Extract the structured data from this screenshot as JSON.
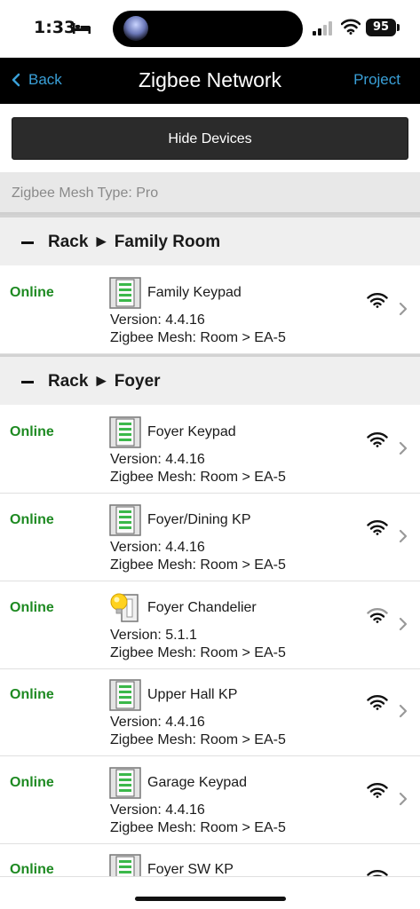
{
  "status_bar": {
    "time": "1:33",
    "battery": "95"
  },
  "nav": {
    "back_label": "Back",
    "title": "Zigbee Network",
    "project_label": "Project"
  },
  "toolbar": {
    "hide_devices_label": "Hide Devices"
  },
  "mesh_type": "Zigbee Mesh Type: Pro",
  "colors": {
    "online": "#1e8a22",
    "nav_link": "#3aa0d8",
    "nav_bg": "#000000"
  },
  "sections": [
    {
      "title": "Rack ► Family Room"
    },
    {
      "title": "Rack ► Foyer"
    }
  ],
  "devices": [
    {
      "status": "Online",
      "name": "Family Keypad",
      "version": "Version: 4.4.16",
      "mesh": "Zigbee Mesh: Room > EA-5",
      "icon": "keypad-icon"
    },
    {
      "status": "Online",
      "name": "Foyer Keypad",
      "version": "Version: 4.4.16",
      "mesh": "Zigbee Mesh: Room > EA-5",
      "icon": "keypad-icon"
    },
    {
      "status": "Online",
      "name": "Foyer/Dining KP",
      "version": "Version: 4.4.16",
      "mesh": "Zigbee Mesh: Room > EA-5",
      "icon": "keypad-icon"
    },
    {
      "status": "Online",
      "name": "Foyer Chandelier",
      "version": "Version: 5.1.1",
      "mesh": "Zigbee Mesh: Room > EA-5",
      "icon": "dimmer-bulb-icon"
    },
    {
      "status": "Online",
      "name": "Upper Hall KP",
      "version": "Version: 4.4.16",
      "mesh": "Zigbee Mesh: Room > EA-5",
      "icon": "keypad-icon"
    },
    {
      "status": "Online",
      "name": "Garage Keypad",
      "version": "Version: 4.4.16",
      "mesh": "Zigbee Mesh: Room > EA-5",
      "icon": "keypad-icon"
    },
    {
      "status": "Online",
      "name": "Foyer SW KP",
      "version": "",
      "mesh": "",
      "icon": "keypad-icon"
    }
  ]
}
